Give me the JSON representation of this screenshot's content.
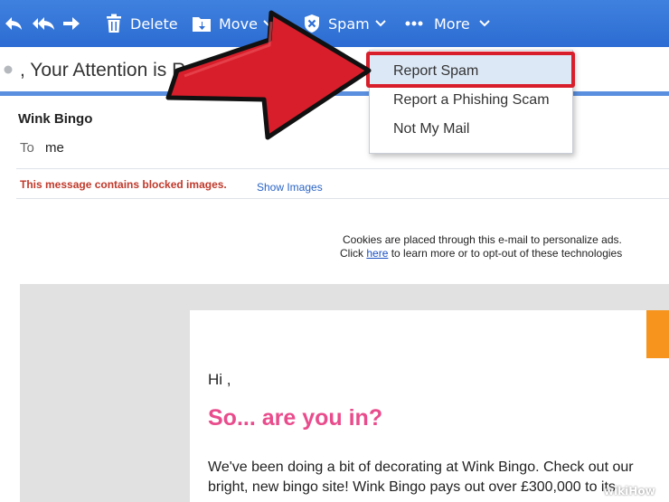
{
  "toolbar": {
    "delete_label": "Delete",
    "move_label": "Move",
    "spam_label": "Spam",
    "more_label": "More",
    "icons": [
      "back-icon",
      "reply-all-icon",
      "forward-icon",
      "trash-icon",
      "move-folder-icon",
      "spam-shield-icon",
      "more-dots-icon",
      "chevron-down-icon"
    ]
  },
  "message": {
    "subject": ", Your Attention is Requir",
    "sender": "Wink Bingo",
    "to_label": "To",
    "to_value": "me",
    "blocked_notice": "This message contains blocked images.",
    "show_images": "Show Images"
  },
  "email_body": {
    "cookies_line1": "Cookies are placed through this e-mail to personalize ads.",
    "cookies_line2_before": "Click",
    "cookies_link": "here",
    "cookies_line2_after": "to learn more or to opt-out of these technologies",
    "greeting": "Hi ,",
    "headline": "So... are you in?",
    "paragraph_line1": "We've been doing a bit of decorating at Wink Bingo. Check out our",
    "paragraph_line2": "bright, new bingo site! Wink Bingo pays out over £300,000 to its"
  },
  "spam_menu": {
    "items": [
      "Report Spam",
      "Report a Phishing Scam",
      "Not My Mail"
    ],
    "highlighted": "Report Spam"
  },
  "watermark": "wikiHow",
  "colors": {
    "toolbar": "#2f6fd6",
    "arrow": "#d81e2a",
    "highlight_border": "#d81e2a",
    "headline": "#e94c8c",
    "blocked_text": "#c0392b"
  }
}
